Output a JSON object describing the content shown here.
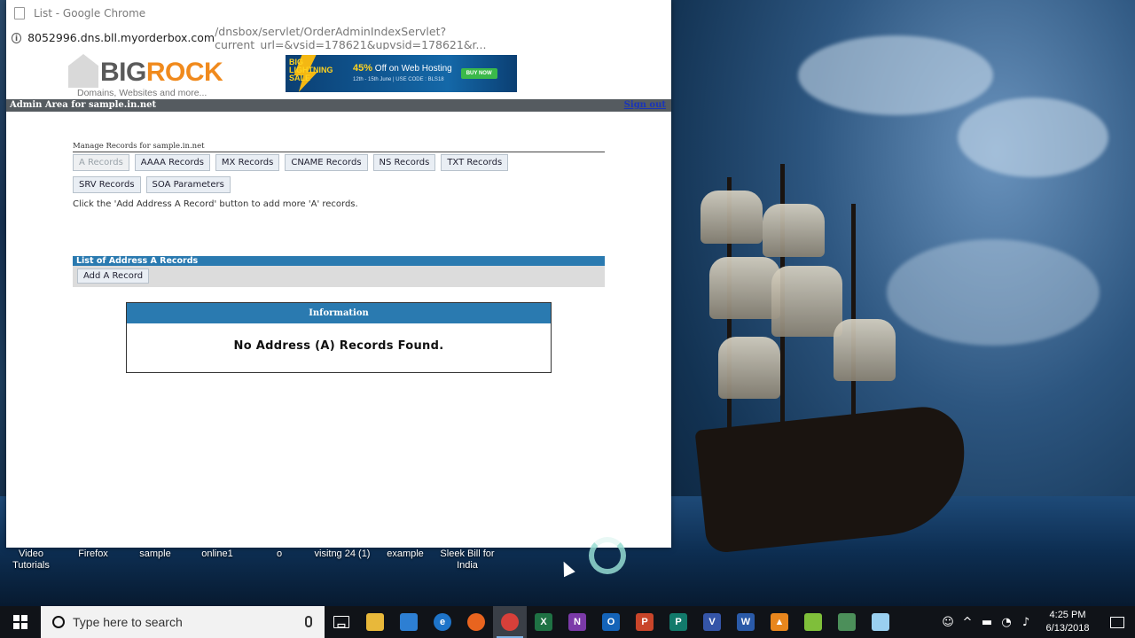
{
  "window": {
    "title": "List - Google Chrome",
    "url_host": "8052996.dns.bll.myorderbox.com",
    "url_path": "/dnsbox/servlet/OrderAdminIndexServlet?current_url=&vsid=178621&upvsid=178621&r..."
  },
  "header": {
    "logo_big": "BIG",
    "logo_rock": "ROCK",
    "logo_tagline": "Domains, Websites and more...",
    "banner_sale": "BIG LIGHTNING SALE",
    "banner_offer_pct": "45%",
    "banner_offer_text": " Off on Web Hosting",
    "banner_dates": "12th - 15th June | USE CODE : BLS18",
    "banner_button": "BUY NOW"
  },
  "admin_bar": {
    "title": "Admin Area for sample.in.net",
    "signout": "Sign out"
  },
  "manage": {
    "title": "Manage Records for sample.in.net",
    "tabs": [
      {
        "label": "A Records",
        "active": true
      },
      {
        "label": "AAAA Records",
        "active": false
      },
      {
        "label": "MX Records",
        "active": false
      },
      {
        "label": "CNAME Records",
        "active": false
      },
      {
        "label": "NS Records",
        "active": false
      },
      {
        "label": "TXT Records",
        "active": false
      },
      {
        "label": "SRV Records",
        "active": false
      },
      {
        "label": "SOA Parameters",
        "active": false
      }
    ],
    "hint": "Click the 'Add Address A Record' button to add more 'A' records."
  },
  "list": {
    "header": "List of Address A Records",
    "add_button": "Add A Record"
  },
  "info": {
    "heading": "Information",
    "message": "No Address (A) Records Found."
  },
  "desktop_labels": [
    "Video Tutorials",
    "Firefox",
    "sample",
    "online1",
    "o",
    "visitng 24 (1)",
    "example",
    "Sleek Bill for India"
  ],
  "taskbar": {
    "search_placeholder": "Type here to search",
    "apps": [
      {
        "name": "task-view-icon",
        "glyph": "▭",
        "color": "transparent"
      },
      {
        "name": "file-explorer-icon",
        "glyph": "",
        "color": "#e8b83a"
      },
      {
        "name": "store-icon",
        "glyph": "",
        "color": "#2d7fd3"
      },
      {
        "name": "edge-icon",
        "glyph": "e",
        "color": "#1e74c9"
      },
      {
        "name": "firefox-icon",
        "glyph": "",
        "color": "#e8641f"
      },
      {
        "name": "chrome-icon",
        "glyph": "",
        "color": "#d8403a"
      },
      {
        "name": "excel-icon",
        "glyph": "X",
        "color": "#1f7244"
      },
      {
        "name": "onenote-icon",
        "glyph": "N",
        "color": "#7b3aa8"
      },
      {
        "name": "outlook-icon",
        "glyph": "O",
        "color": "#1463b8"
      },
      {
        "name": "powerpoint-icon",
        "glyph": "P",
        "color": "#c9452a"
      },
      {
        "name": "publisher-icon",
        "glyph": "P",
        "color": "#127a6b"
      },
      {
        "name": "visio-icon",
        "glyph": "V",
        "color": "#3555a8"
      },
      {
        "name": "word-icon",
        "glyph": "W",
        "color": "#2a5aa8"
      },
      {
        "name": "vlc-icon",
        "glyph": "▲",
        "color": "#e8861d"
      },
      {
        "name": "notepad-plus-icon",
        "glyph": "",
        "color": "#7fbf3a"
      },
      {
        "name": "app-icon",
        "glyph": "",
        "color": "#4c8f5a"
      },
      {
        "name": "paint-icon",
        "glyph": "",
        "color": "#9ad0f0"
      }
    ],
    "time": "4:25 PM",
    "date": "6/13/2018"
  }
}
